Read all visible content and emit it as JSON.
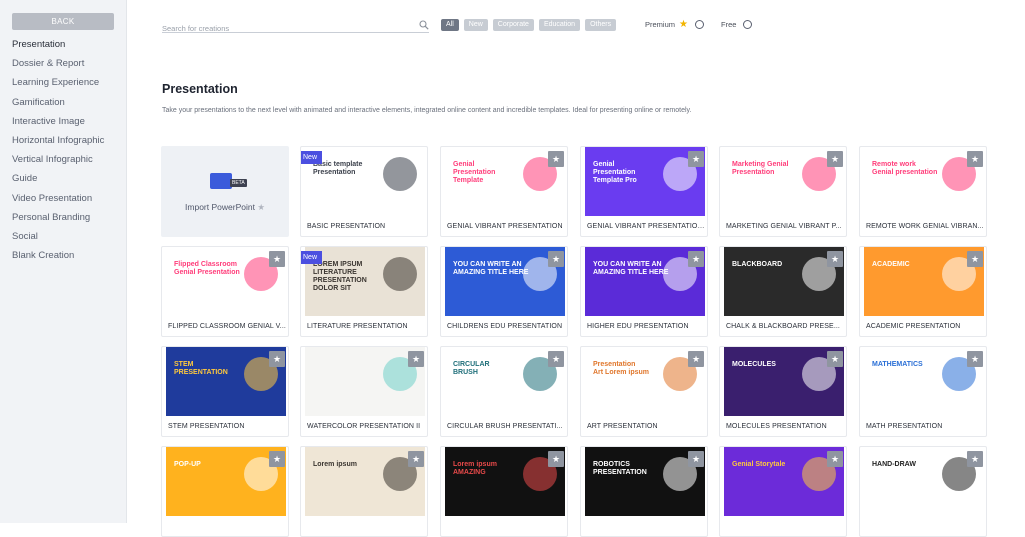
{
  "sidebar": {
    "back_label": "BACK",
    "items": [
      "Presentation",
      "Dossier & Report",
      "Learning Experience",
      "Gamification",
      "Interactive Image",
      "Horizontal Infographic",
      "Vertical Infographic",
      "Guide",
      "Video Presentation",
      "Personal Branding",
      "Social",
      "Blank Creation"
    ],
    "active": "Presentation"
  },
  "search": {
    "placeholder": "Search for creations"
  },
  "filters": [
    "All",
    "New",
    "Corporate",
    "Education",
    "Others"
  ],
  "active_filter": "All",
  "options": {
    "premium": "Premium",
    "free": "Free"
  },
  "section": {
    "title": "Presentation",
    "description": "Take your presentations to the next level with animated and interactive elements, integrated online content and incredible templates. Ideal for presenting online or remotely."
  },
  "import": {
    "label": "Import PowerPoint",
    "badge": "BETA"
  },
  "new_badge": "New",
  "cards": [
    {
      "label": "BASIC PRESENTATION",
      "new": true,
      "bg": "#ffffff",
      "accent": "#3a3f4a",
      "text": "Basic template\nPresentation"
    },
    {
      "label": "GENIAL VIBRANT PRESENTATION",
      "bg": "#ffffff",
      "accent": "#ff3d7a",
      "text": "Genial\nPresentation\nTemplate"
    },
    {
      "label": "GENIAL VIBRANT PRESENTATION...",
      "bg": "#6a3cf0",
      "accent": "#ffffff",
      "text": "Genial\nPresentation\nTemplate Pro"
    },
    {
      "label": "MARKETING GENIAL VIBRANT P...",
      "bg": "#ffffff",
      "accent": "#ff3d7a",
      "text": "Marketing Genial\nPresentation"
    },
    {
      "label": "REMOTE WORK GENIAL VIBRAN...",
      "bg": "#ffffff",
      "accent": "#ff3d7a",
      "text": "Remote work\nGenial presentation"
    },
    {
      "label": "FLIPPED CLASSROOM GENIAL V...",
      "bg": "#ffffff",
      "accent": "#ff3d7a",
      "text": "Flipped Classroom\nGenial Presentation"
    },
    {
      "label": "LITERATURE PRESENTATION",
      "new": true,
      "bg": "#e9e2d6",
      "accent": "#3a3530",
      "text": "LOREM IPSUM\nLITERATURE\nPRESENTATION\nDOLOR SIT"
    },
    {
      "label": "CHILDRENS EDU PRESENTATION",
      "bg": "#2d5bd6",
      "accent": "#ffffff",
      "text": "YOU CAN WRITE AN\nAMAZING TITLE HERE"
    },
    {
      "label": "HIGHER EDU PRESENTATION",
      "bg": "#5b2bd8",
      "accent": "#ffffff",
      "text": "YOU CAN WRITE AN\nAMAZING TITLE HERE"
    },
    {
      "label": "CHALK & BLACKBOARD PRESE...",
      "bg": "#2a2a2a",
      "accent": "#ffffff",
      "text": "BLACKBOARD"
    },
    {
      "label": "ACADEMIC PRESENTATION",
      "bg": "#ff9a2e",
      "accent": "#ffffff",
      "text": "ACADEMIC"
    },
    {
      "label": "STEM PRESENTATION",
      "bg": "#1f3b9c",
      "accent": "#ffc93d",
      "text": "STEM\nPRESENTATION"
    },
    {
      "label": "WATERCOLOR PRESENTATION II",
      "bg": "#f5f5f3",
      "accent": "#6fcfc8",
      "text": ""
    },
    {
      "label": "CIRCULAR BRUSH PRESENTATI...",
      "bg": "#ffffff",
      "accent": "#1f6f7a",
      "text": "CIRCULAR\nBRUSH"
    },
    {
      "label": "ART PRESENTATION",
      "bg": "#ffffff",
      "accent": "#e0762b",
      "text": "Presentation\nArt Lorem ipsum"
    },
    {
      "label": "MOLECULES PRESENTATION",
      "bg": "#3a1f6e",
      "accent": "#ffffff",
      "text": "MOLECULES"
    },
    {
      "label": "MATH PRESENTATION",
      "bg": "#ffffff",
      "accent": "#2a6fd6",
      "text": "MATHEMATICS"
    },
    {
      "label": "",
      "bg": "#ffb21e",
      "accent": "#ffffff",
      "text": "POP-UP"
    },
    {
      "label": "",
      "bg": "#efe6d6",
      "accent": "#3a3530",
      "text": "Lorem ipsum"
    },
    {
      "label": "",
      "bg": "#111111",
      "accent": "#e84a4a",
      "text": "Lorem ipsum\nAMAZING"
    },
    {
      "label": "",
      "bg": "#111111",
      "accent": "#ffffff",
      "text": "ROBOTICS\nPRESENTATION"
    },
    {
      "label": "",
      "bg": "#6c2bd9",
      "accent": "#ffc93d",
      "text": "Genial Storytale"
    },
    {
      "label": "",
      "bg": "#ffffff",
      "accent": "#222222",
      "text": "HAND-DRAW"
    }
  ]
}
